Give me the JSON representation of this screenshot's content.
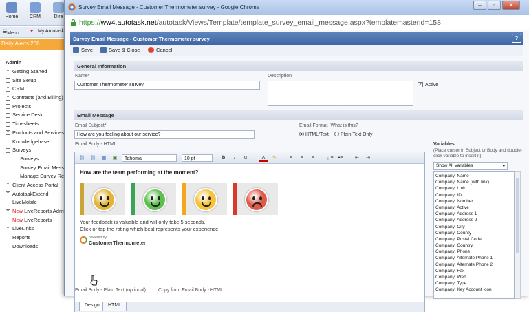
{
  "topnav": {
    "items": [
      {
        "label": "Home",
        "icon": "home-icon"
      },
      {
        "label": "CRM",
        "icon": "crm-icon"
      },
      {
        "label": "Dire",
        "icon": "directory-icon"
      }
    ]
  },
  "menubar": {
    "menu_label": "Menu",
    "my_label": "My Autotask"
  },
  "alerts": {
    "label": "Daily Alerts:208"
  },
  "leftnav": {
    "title": "Admin",
    "items": [
      {
        "label": "Getting Started",
        "expand": true,
        "new": false,
        "indent": 0
      },
      {
        "label": "Site Setup",
        "expand": true,
        "new": false,
        "indent": 0
      },
      {
        "label": "CRM",
        "expand": true,
        "new": false,
        "indent": 0
      },
      {
        "label": "Contracts (and Billing)",
        "expand": true,
        "new": false,
        "indent": 0
      },
      {
        "label": "Projects",
        "expand": true,
        "new": false,
        "indent": 0
      },
      {
        "label": "Service Desk",
        "expand": true,
        "new": false,
        "indent": 0
      },
      {
        "label": "Timesheets",
        "expand": true,
        "new": false,
        "indent": 0
      },
      {
        "label": "Products and Services",
        "expand": true,
        "new": false,
        "indent": 0
      },
      {
        "label": "Knowledgebase",
        "expand": false,
        "new": false,
        "indent": 0
      },
      {
        "label": "Surveys",
        "expand": true,
        "new": false,
        "indent": 0
      },
      {
        "label": "Surveys",
        "expand": false,
        "new": false,
        "indent": 1
      },
      {
        "label": "Survey Email Message",
        "expand": false,
        "new": false,
        "indent": 1
      },
      {
        "label": "Manage Survey Resp",
        "expand": false,
        "new": false,
        "indent": 1
      },
      {
        "label": "Client Access Portal",
        "expand": true,
        "new": false,
        "indent": 0
      },
      {
        "label": "AutotaskExtend",
        "expand": true,
        "new": false,
        "indent": 0
      },
      {
        "label": "LiveMobile",
        "expand": false,
        "new": false,
        "indent": 0
      },
      {
        "label": "LiveReports Admini",
        "expand": true,
        "new": true,
        "indent": 0
      },
      {
        "label": "LiveReports",
        "expand": false,
        "new": true,
        "indent": 0
      },
      {
        "label": "LiveLinks",
        "expand": true,
        "new": false,
        "indent": 0
      },
      {
        "label": "Reports",
        "expand": false,
        "new": false,
        "indent": 0
      },
      {
        "label": "Downloads",
        "expand": false,
        "new": false,
        "indent": 0
      }
    ],
    "new_label": "New"
  },
  "window": {
    "title": "Survey Email Message - Customer Thermometer survey - Google Chrome",
    "url_scheme": "https://",
    "url_host": "ww4.autotask.net",
    "url_path": "/autotask/Views/Template/template_survey_email_message.aspx?templatemasterid=158"
  },
  "page": {
    "header": "Survey Email Message - Customer Thermometer survey",
    "help": "?",
    "toolbar": {
      "save": "Save",
      "save_close": "Save & Close",
      "cancel": "Cancel"
    },
    "general": {
      "section": "General Information",
      "name_label": "Name",
      "name_value": "Customer Thermometer survey",
      "description_label": "Description",
      "description_value": "",
      "active_label": "Active",
      "active_checked": true
    },
    "email": {
      "section": "Email Message",
      "subject_label": "Email Subject",
      "subject_value": "How are you feeling about our service?",
      "format_label": "Email Format",
      "what_is_this": "What is this?",
      "format_html": "HTML/Text",
      "format_plain": "Plain Text Only",
      "body_label": "Email Body - HTML",
      "plain_label": "Email Body - Plain Text (optional)",
      "copy_label": "Copy from Email Body - HTML"
    },
    "editor": {
      "font": "Tahoma",
      "size": "10 pt",
      "bold": "b",
      "italic": "i",
      "underline": "u",
      "color": "A",
      "heading": "How are the team performing at the moment?",
      "line1": "Your feedback is valuable and will only take 5 seconds.",
      "line2": "Click or tap the rating which best represents your experience.",
      "powered": "powered by",
      "brand": "CustomerThermometer",
      "tab_design": "Design",
      "tab_html": "HTML"
    },
    "variables": {
      "title": "Variables",
      "hint": "(Place cursor in Subject or Body and double-click variable to insert it)",
      "filter": "Show All Variables",
      "list": [
        "Company: Name",
        "Company: Name (with link)",
        "Company: Link",
        "Company: ID",
        "Company: Number",
        "Company: Active",
        "Company: Address 1",
        "Company: Address 2",
        "Company: City",
        "Company: County",
        "Company: Postal Code",
        "Company: Country",
        "Company: Phone",
        "Company: Alternate Phone 1",
        "Company: Alternate Phone 2",
        "Company: Fax",
        "Company: Web",
        "Company: Type",
        "Company: Key Account Icon"
      ]
    }
  },
  "faces": [
    {
      "name": "gold-face-icon",
      "bar": "#c9a437",
      "ball": "#e3b437"
    },
    {
      "name": "green-face-icon",
      "bar": "#3aa655",
      "ball": "#5cbf4d"
    },
    {
      "name": "yellow-face-icon",
      "bar": "#f4a521",
      "ball": "#f4c33a"
    },
    {
      "name": "red-face-icon",
      "bar": "#d83b2b",
      "ball": "#e05a4a"
    }
  ]
}
